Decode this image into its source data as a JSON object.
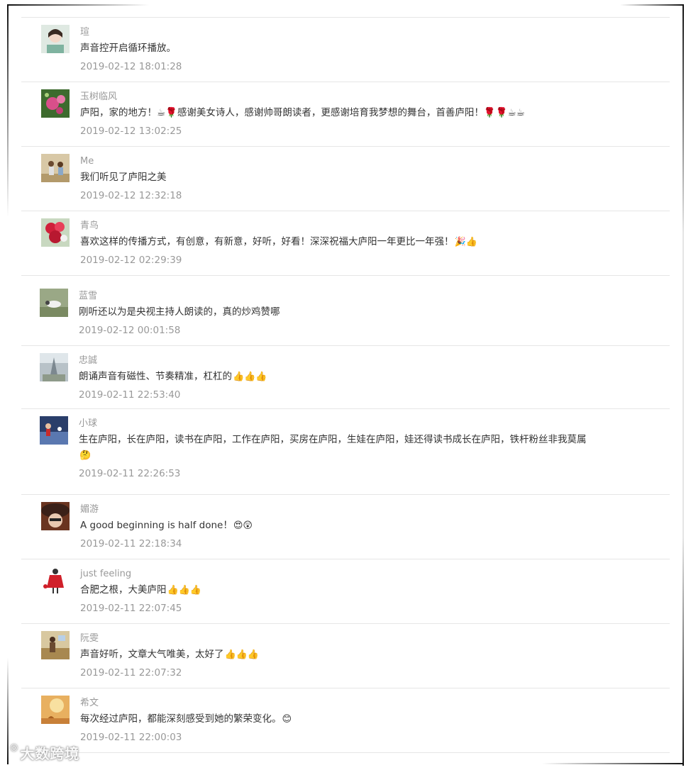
{
  "comments": [
    {
      "nickname": "瑄",
      "text": "声音控开启循环播放。",
      "emoji": "",
      "time": "2019-02-12 18:01:28"
    },
    {
      "nickname": "玉树临风",
      "text": "庐阳，家的地方！☕🌹感谢美女诗人，感谢帅哥朗读者，更感谢培育我梦想的舞台，首善庐阳！🌹🌹☕☕",
      "emoji": "",
      "time": "2019-02-12 13:02:25"
    },
    {
      "nickname": "Me",
      "text": "我们听见了庐阳之美",
      "emoji": "",
      "time": "2019-02-12 12:32:18"
    },
    {
      "nickname": "青鸟",
      "text": "喜欢这样的传播方式，有创意，有新意，好听，好看！深深祝福大庐阳一年更比一年强！",
      "emoji": "🎉👍",
      "time": "2019-02-12 02:29:39"
    },
    {
      "nickname": "蓝雪",
      "text": "刚听还以为是央视主持人朗读的，真的炒鸡赞哪",
      "emoji": "",
      "time": "2019-02-12 00:01:58"
    },
    {
      "nickname": "忠誠",
      "text": "朗诵声音有磁性、节奏精准，杠杠的",
      "emoji": "👍👍👍",
      "time": "2019-02-11 22:53:40"
    },
    {
      "nickname": "小球",
      "text": "生在庐阳，长在庐阳，读书在庐阳，工作在庐阳，买房在庐阳，生娃在庐阳，娃还得读书成长在庐阳，铁杆粉丝非我莫属",
      "emoji": "🤔",
      "time": "2019-02-11 22:26:53"
    },
    {
      "nickname": "媚游",
      "text": "A good beginning is half done！",
      "emoji": "😍😲",
      "time": "2019-02-11 22:18:34"
    },
    {
      "nickname": "just feeling",
      "text": "合肥之根，大美庐阳",
      "emoji": "👍👍👍",
      "time": "2019-02-11 22:07:45"
    },
    {
      "nickname": "阮雯",
      "text": "声音好听，文章大气唯美，太好了",
      "emoji": "👍👍👍",
      "time": "2019-02-11 22:07:32"
    },
    {
      "nickname": "希文",
      "text": "每次经过庐阳，都能深刻感受到她的繁荣变化。",
      "emoji": "😊",
      "time": "2019-02-11 22:00:03"
    }
  ],
  "watermark": "大数跨境"
}
